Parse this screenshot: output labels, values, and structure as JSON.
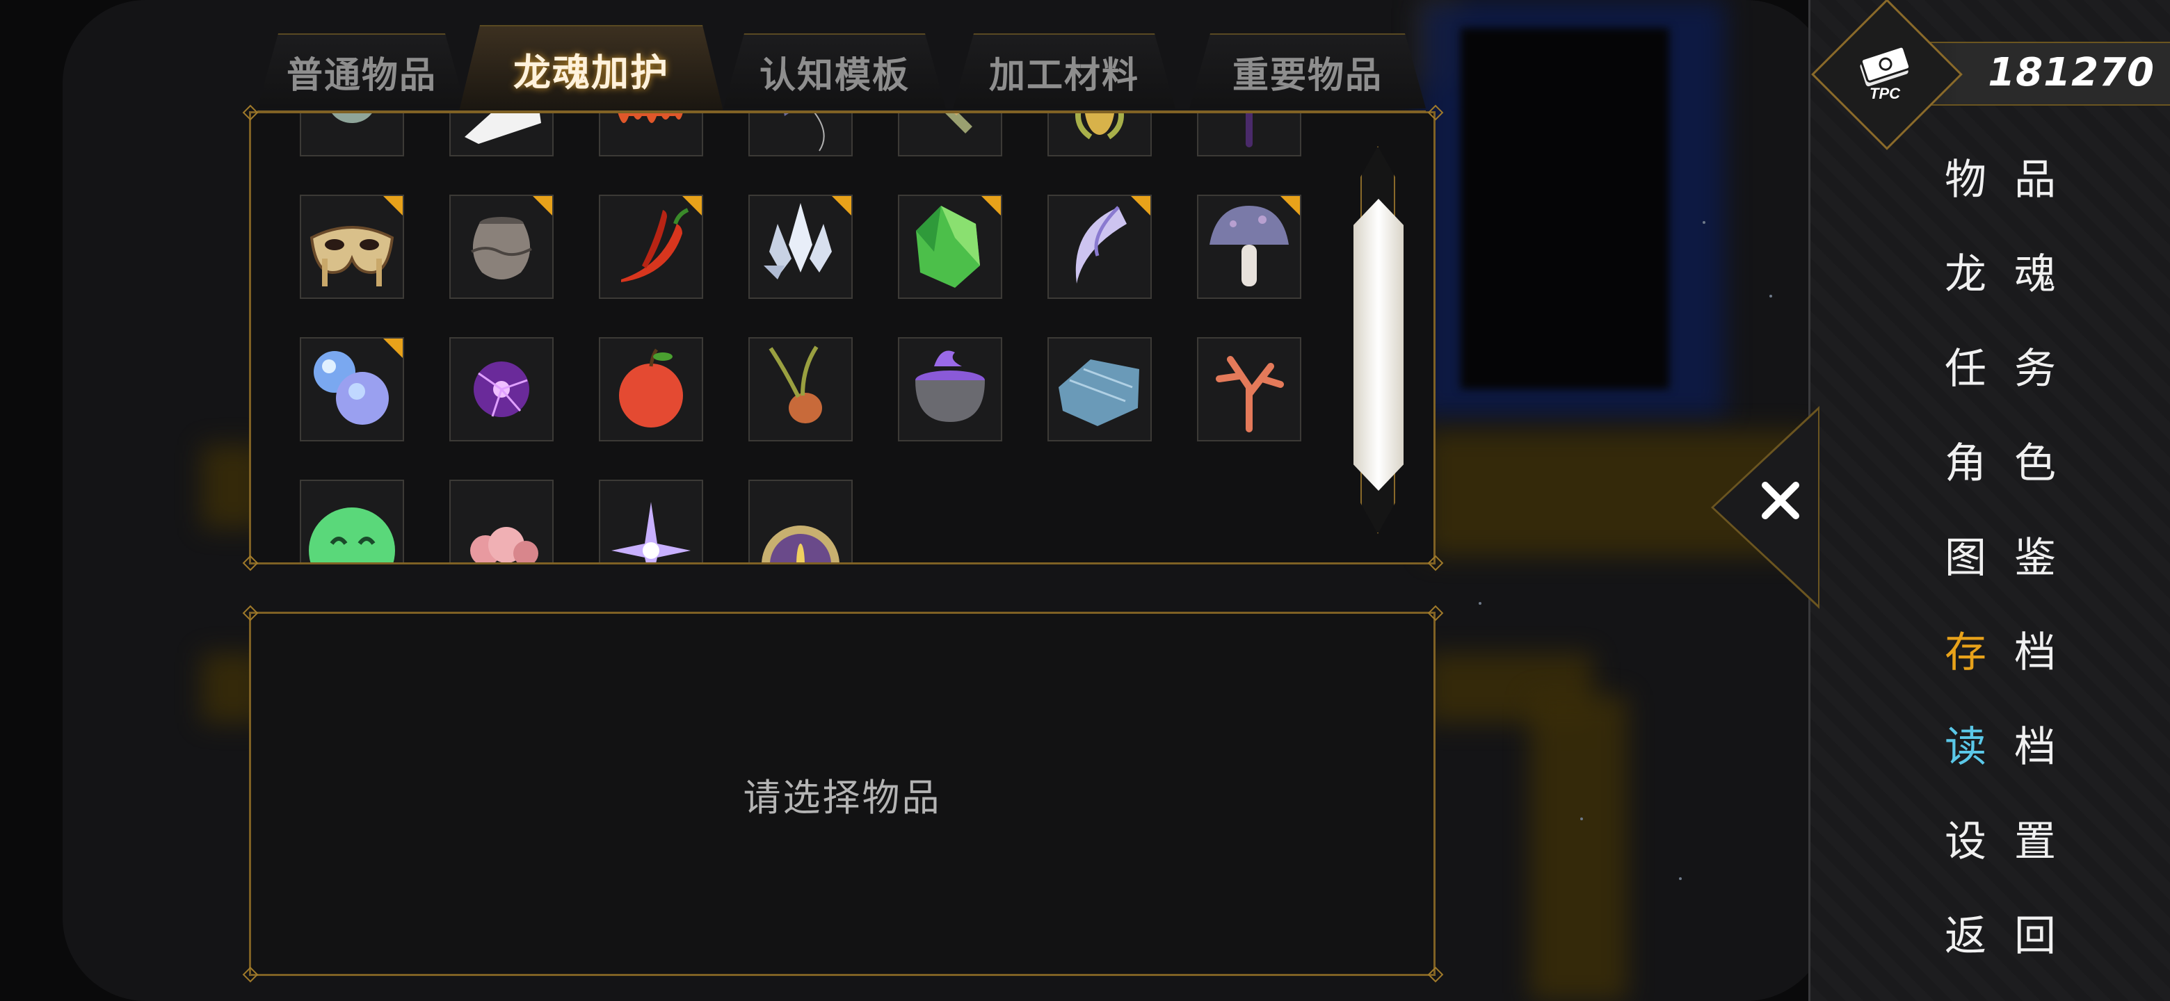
{
  "tabs": [
    {
      "label": "普通物品",
      "active": false
    },
    {
      "label": "龙魂加护",
      "active": true
    },
    {
      "label": "认知模板",
      "active": false
    },
    {
      "label": "加工材料",
      "active": false
    },
    {
      "label": "重要物品",
      "active": false
    }
  ],
  "items": [
    {
      "icon": "stone-icon",
      "new": false
    },
    {
      "icon": "paper-icon",
      "new": false
    },
    {
      "icon": "lava-icon",
      "new": false
    },
    {
      "icon": "crystal-pendant-icon",
      "new": false
    },
    {
      "icon": "dagger-icon",
      "new": false
    },
    {
      "icon": "corn-icon",
      "new": false
    },
    {
      "icon": "dark-coral-icon",
      "new": false
    },
    {
      "icon": "mask-icon",
      "new": true
    },
    {
      "icon": "clay-pot-icon",
      "new": true
    },
    {
      "icon": "chili-pepper-icon",
      "new": true
    },
    {
      "icon": "white-crystal-icon",
      "new": true
    },
    {
      "icon": "green-ore-icon",
      "new": true
    },
    {
      "icon": "fang-icon",
      "new": true
    },
    {
      "icon": "mushroom-icon",
      "new": true
    },
    {
      "icon": "slime-gem-icon",
      "new": true
    },
    {
      "icon": "plasma-orb-icon",
      "new": false
    },
    {
      "icon": "apple-icon",
      "new": false
    },
    {
      "icon": "onion-root-icon",
      "new": false
    },
    {
      "icon": "cauldron-icon",
      "new": false
    },
    {
      "icon": "blue-ore-icon",
      "new": false
    },
    {
      "icon": "red-coral-icon",
      "new": false
    },
    {
      "icon": "green-slime-icon",
      "new": false
    },
    {
      "icon": "pink-cloud-icon",
      "new": false
    },
    {
      "icon": "star-burst-icon",
      "new": false
    },
    {
      "icon": "eye-orb-icon",
      "new": false
    }
  ],
  "detail": {
    "placeholder": "请选择物品"
  },
  "currency": {
    "amount": "181270",
    "badge": "TPC"
  },
  "menu": [
    {
      "first": "物",
      "second": "品",
      "accent": ""
    },
    {
      "first": "龙",
      "second": "魂",
      "accent": ""
    },
    {
      "first": "任",
      "second": "务",
      "accent": ""
    },
    {
      "first": "角",
      "second": "色",
      "accent": ""
    },
    {
      "first": "图",
      "second": "鉴",
      "accent": ""
    },
    {
      "first": "存",
      "second": "档",
      "accent": "#e8a21a"
    },
    {
      "first": "读",
      "second": "档",
      "accent": "#5bc8e8"
    },
    {
      "first": "设",
      "second": "置",
      "accent": ""
    },
    {
      "first": "返",
      "second": "回",
      "accent": ""
    }
  ],
  "colors": {
    "gold": "#e8a21a",
    "frame": "#7f6124",
    "cyan": "#5bc8e8"
  }
}
